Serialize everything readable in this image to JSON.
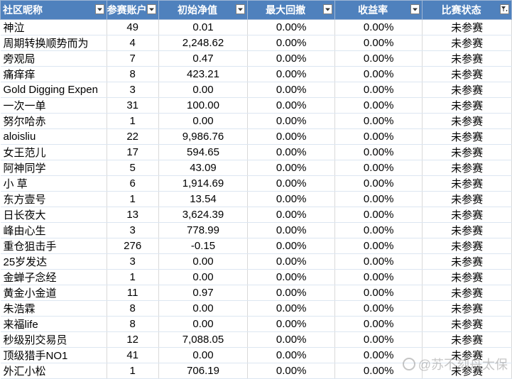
{
  "columns": [
    {
      "label": "社区昵称",
      "filter": "dropdown"
    },
    {
      "label": "参赛账户",
      "filter": "dropdown"
    },
    {
      "label": "初始净值",
      "filter": "dropdown"
    },
    {
      "label": "最大回撤",
      "filter": "dropdown"
    },
    {
      "label": "收益率",
      "filter": "dropdown"
    },
    {
      "label": "比赛状态",
      "filter": "filtered"
    }
  ],
  "rows": [
    [
      "神泣",
      "49",
      "0.01",
      "0.00%",
      "0.00%",
      "未参赛"
    ],
    [
      "周期转换顺势而为",
      "4",
      "2,248.62",
      "0.00%",
      "0.00%",
      "未参赛"
    ],
    [
      "旁观局",
      "7",
      "0.47",
      "0.00%",
      "0.00%",
      "未参赛"
    ],
    [
      "痛痒痒",
      "8",
      "423.21",
      "0.00%",
      "0.00%",
      "未参赛"
    ],
    [
      "Gold Digging Expen",
      "3",
      "0.00",
      "0.00%",
      "0.00%",
      "未参赛"
    ],
    [
      "一次一单",
      "31",
      "100.00",
      "0.00%",
      "0.00%",
      "未参赛"
    ],
    [
      "努尔哈赤",
      "1",
      "0.00",
      "0.00%",
      "0.00%",
      "未参赛"
    ],
    [
      "aloisliu",
      "22",
      "9,986.76",
      "0.00%",
      "0.00%",
      "未参赛"
    ],
    [
      "女王范儿",
      "17",
      "594.65",
      "0.00%",
      "0.00%",
      "未参赛"
    ],
    [
      "阿神同学",
      "5",
      "43.09",
      "0.00%",
      "0.00%",
      "未参赛"
    ],
    [
      "小 草",
      "6",
      "1,914.69",
      "0.00%",
      "0.00%",
      "未参赛"
    ],
    [
      "东方壹号",
      "1",
      "13.54",
      "0.00%",
      "0.00%",
      "未参赛"
    ],
    [
      "日长夜大",
      "13",
      "3,624.39",
      "0.00%",
      "0.00%",
      "未参赛"
    ],
    [
      "峰由心生",
      "3",
      "778.99",
      "0.00%",
      "0.00%",
      "未参赛"
    ],
    [
      "重仓狙击手",
      "276",
      "-0.15",
      "0.00%",
      "0.00%",
      "未参赛"
    ],
    [
      "25岁发达",
      "3",
      "0.00",
      "0.00%",
      "0.00%",
      "未参赛"
    ],
    [
      "金蝉子念经",
      "1",
      "0.00",
      "0.00%",
      "0.00%",
      "未参赛"
    ],
    [
      "黄金小金道",
      "11",
      "0.97",
      "0.00%",
      "0.00%",
      "未参赛"
    ],
    [
      "朱浩霖",
      "8",
      "0.00",
      "0.00%",
      "0.00%",
      "未参赛"
    ],
    [
      "来福life",
      "8",
      "0.00",
      "0.00%",
      "0.00%",
      "未参赛"
    ],
    [
      "秒级别交易员",
      "12",
      "7,088.05",
      "0.00%",
      "0.00%",
      "未参赛"
    ],
    [
      "顶级猎手NO1",
      "41",
      "0.00",
      "0.00%",
      "0.00%",
      "未参赛"
    ],
    [
      "外汇小松",
      "1",
      "706.19",
      "0.00%",
      "0.00%",
      "未参赛"
    ]
  ],
  "watermark": "@苏不刻舟太保",
  "colors": {
    "header_bg": "#4f81bd",
    "header_text": "#ffffff",
    "grid": "#d9d9d9"
  }
}
